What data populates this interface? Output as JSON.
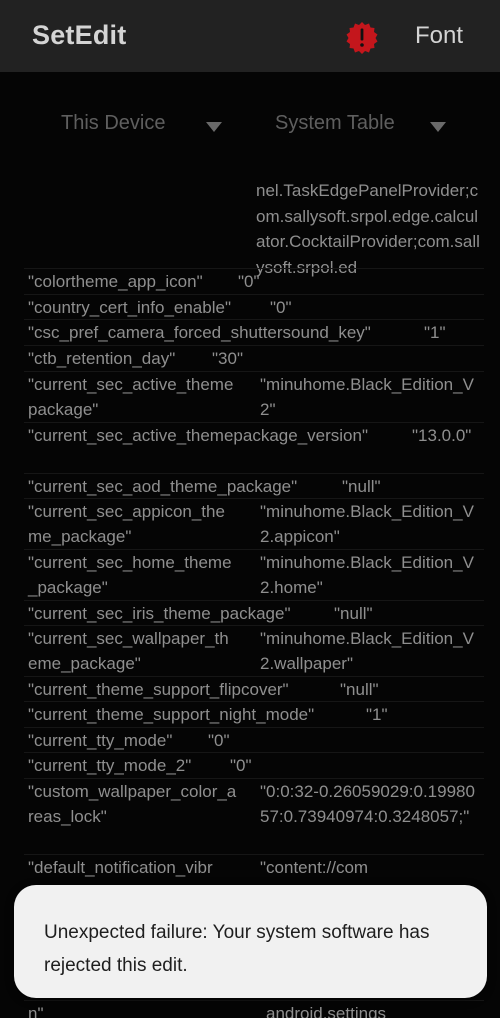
{
  "appbar": {
    "title": "SetEdit",
    "warning_icon": "exclamation-circle-icon",
    "warning_color": "#c4161c",
    "font_label": "Font"
  },
  "selectors": {
    "device_label": "This Device",
    "table_label": "System Table"
  },
  "continuation_text": "nel.TaskEdgePanelProvider;com.sallysoft.srpol.edge.calculator.CocktailProvider;com.sallysoft.srpol.ed",
  "rows": [
    {
      "key": "\"colortheme_app_icon\"",
      "value": "\"0\""
    },
    {
      "key": "\"country_cert_info_enable\"",
      "value": "\"0\""
    },
    {
      "key": "\"csc_pref_camera_forced_shuttersound_key\"",
      "value": "\"1\""
    },
    {
      "key": "\"ctb_retention_day\"",
      "value": "\"30\""
    },
    {
      "key": "\"current_sec_active_themepackage\"",
      "value": "\"minuhome.Black_Edition_V2\""
    },
    {
      "key": "\"current_sec_active_themepackage_version\"",
      "value": "\"13.0.0\""
    },
    {
      "key": "\"current_sec_aod_theme_package\"",
      "value": "\"null\""
    },
    {
      "key": "\"current_sec_appicon_theme_package\"",
      "value": "\"minuhome.Black_Edition_V2.appicon\""
    },
    {
      "key": "\"current_sec_home_theme_package\"",
      "value": "\"minuhome.Black_Edition_V2.home\""
    },
    {
      "key": "\"current_sec_iris_theme_package\"",
      "value": "\"null\""
    },
    {
      "key": "\"current_sec_wallpaper_theme_package\"",
      "value": "\"minuhome.Black_Edition_V2.wallpaper\""
    },
    {
      "key": "\"current_theme_support_flipcover\"",
      "value": "\"null\""
    },
    {
      "key": "\"current_theme_support_night_mode\"",
      "value": "\"1\""
    },
    {
      "key": "\"current_tty_mode\"",
      "value": "\"0\""
    },
    {
      "key": "\"current_tty_mode_2\"",
      "value": "\"0\""
    },
    {
      "key": "\"custom_wallpaper_color_areas_lock\"",
      "value": "\"0:0:32-0.26059029:0.1998057:0.73940974:0.3248057;\""
    },
    {
      "key": "\"default_notification_vibr",
      "value": "\"content://com"
    },
    {
      "key": "n\"",
      "value": "android.settings"
    }
  ],
  "toast": {
    "message": "Unexpected failure: Your system software has rejected this edit."
  }
}
